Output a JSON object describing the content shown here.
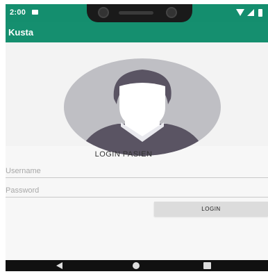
{
  "status_bar": {
    "time": "2:00",
    "icons": [
      "notification-icon",
      "wifi-icon",
      "signal-icon",
      "battery-icon"
    ]
  },
  "app_bar": {
    "title": "Kusta",
    "color": "#158f6f"
  },
  "avatar": {
    "icon": "user-placeholder-icon"
  },
  "login": {
    "title": "LOGIN PASIEN",
    "username_placeholder": "Username",
    "username_value": "",
    "password_placeholder": "Password",
    "password_value": "",
    "button_label": "LOGIN"
  },
  "nav_bar": {
    "icons": [
      "back-icon",
      "home-icon",
      "recents-icon"
    ]
  }
}
